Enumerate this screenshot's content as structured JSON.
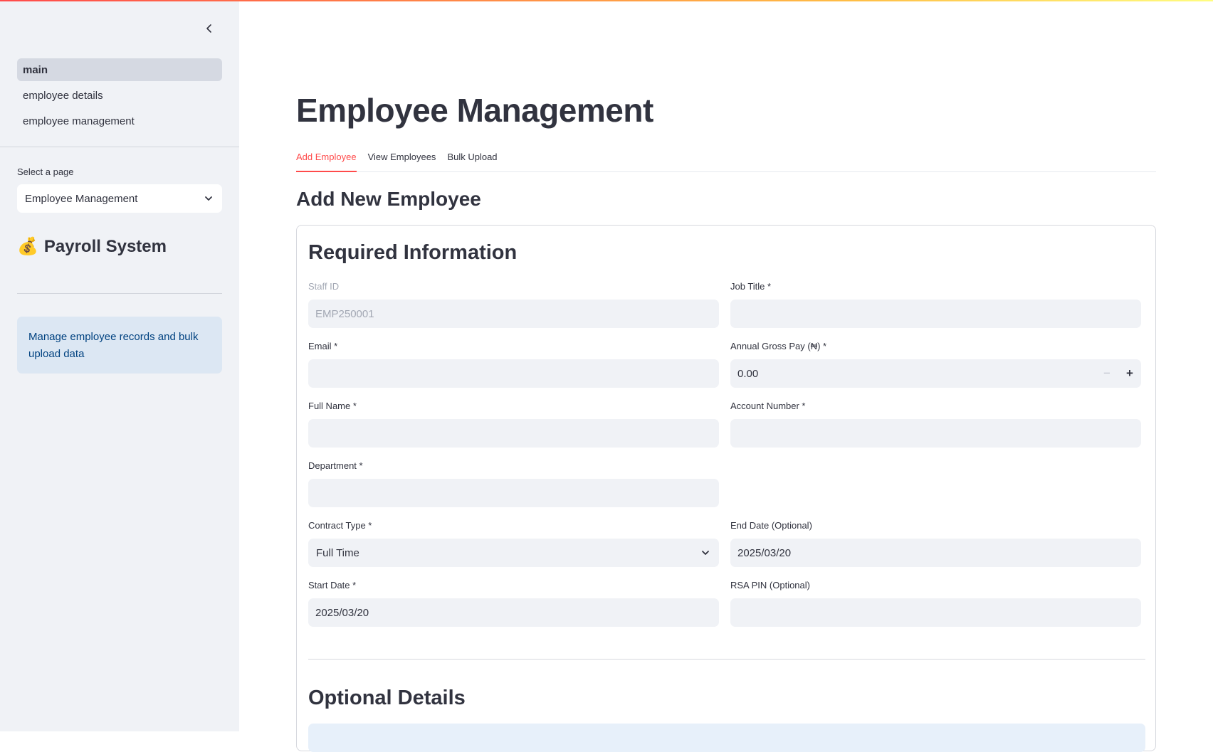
{
  "sidebar": {
    "nav_items": [
      {
        "label": "main",
        "active": true
      },
      {
        "label": "employee details",
        "active": false
      },
      {
        "label": "employee management",
        "active": false
      }
    ],
    "select_label": "Select a page",
    "select_value": "Employee Management",
    "title_emoji": "💰",
    "title": "Payroll System",
    "info_text": "Manage employee records and bulk upload data"
  },
  "main": {
    "page_title": "Employee Management",
    "tabs": [
      {
        "label": "Add Employee",
        "active": true
      },
      {
        "label": "View Employees",
        "active": false
      },
      {
        "label": "Bulk Upload",
        "active": false
      }
    ],
    "section_title": "Add New Employee",
    "form": {
      "heading": "Required Information",
      "fields": {
        "staff_id": {
          "label": "Staff ID",
          "value": "EMP250001"
        },
        "job_title": {
          "label": "Job Title *",
          "value": ""
        },
        "email": {
          "label": "Email *",
          "value": ""
        },
        "annual_gross_pay": {
          "label": "Annual Gross Pay (₦) *",
          "value": "0.00"
        },
        "full_name": {
          "label": "Full Name *",
          "value": ""
        },
        "account_number": {
          "label": "Account Number *",
          "value": ""
        },
        "department": {
          "label": "Department *",
          "value": ""
        },
        "contract_type": {
          "label": "Contract Type *",
          "value": "Full Time"
        },
        "end_date": {
          "label": "End Date (Optional)",
          "value": "2025/03/20"
        },
        "start_date": {
          "label": "Start Date *",
          "value": "2025/03/20"
        },
        "rsa_pin": {
          "label": "RSA PIN (Optional)",
          "value": ""
        }
      },
      "optional_heading": "Optional Details"
    }
  },
  "colors": {
    "accent": "#ff4b4b",
    "sidebar_bg": "#f0f2f6",
    "info_bg": "#dce7f3",
    "info_text": "#004280"
  }
}
